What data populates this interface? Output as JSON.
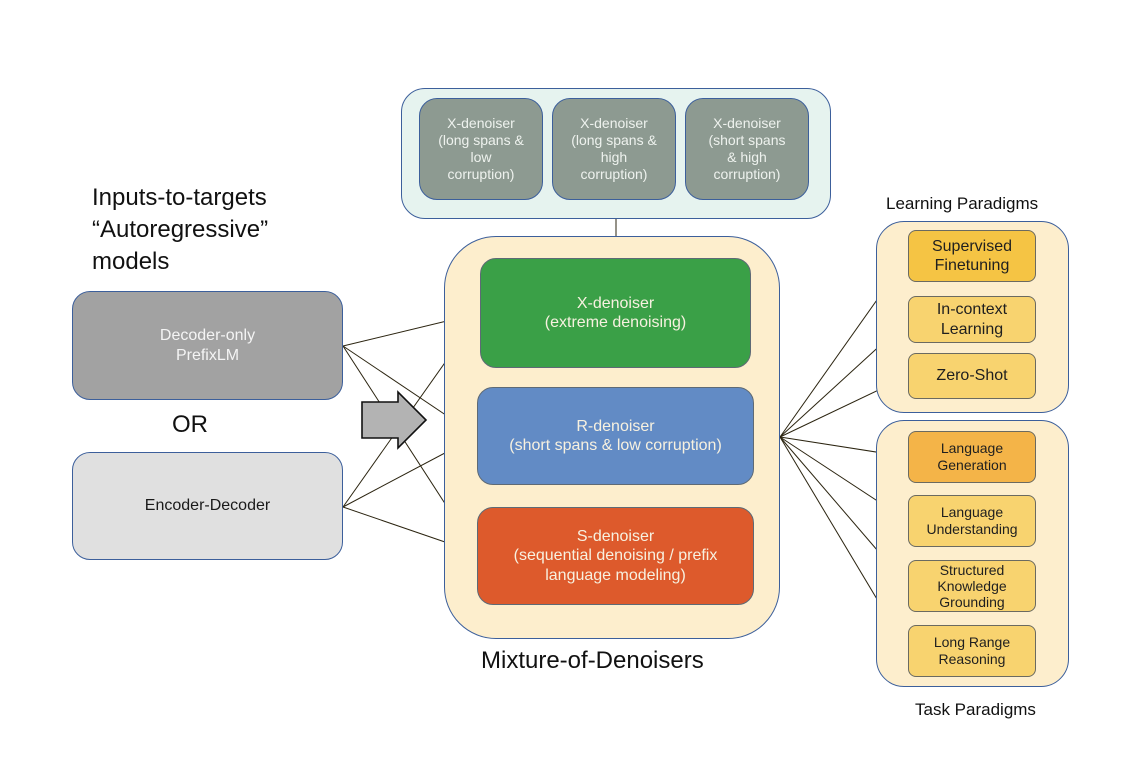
{
  "left": {
    "heading": "Inputs-to-targets\n“Autoregressive”\nmodels",
    "models": [
      {
        "label": "Decoder-only\nPrefixLM",
        "color": "#a2a2a2",
        "text_color": "#f4f4f4"
      },
      {
        "label": "Encoder-Decoder",
        "color": "#e0e0e0",
        "text_color": "#1a1a1a"
      }
    ],
    "or_label": "OR"
  },
  "top_group": {
    "items": [
      {
        "label": "X-denoiser\n(long spans &\nlow\ncorruption)"
      },
      {
        "label": "X-denoiser\n(long spans &\nhigh\ncorruption)"
      },
      {
        "label": "X-denoiser\n(short spans\n& high\ncorruption)"
      }
    ]
  },
  "mixture": {
    "title": "Mixture-of-Denoisers",
    "denoisers": [
      {
        "label": "X-denoiser\n(extreme denoising)",
        "color": "#3aa047"
      },
      {
        "label": "R-denoiser\n(short spans & low corruption)",
        "color": "#628bc5"
      },
      {
        "label": "S-denoiser\n(sequential denoising / prefix\nlanguage modeling)",
        "color": "#dd5a2c"
      }
    ]
  },
  "learning_paradigms": {
    "title": "Learning Paradigms",
    "items": [
      {
        "label": "Supervised\nFinetuning",
        "color": "#f5c444"
      },
      {
        "label": "In-context\nLearning",
        "color": "#f8d36f"
      },
      {
        "label": "Zero-Shot",
        "color": "#f8d36f"
      }
    ]
  },
  "task_paradigms": {
    "title": "Task Paradigms",
    "items": [
      {
        "label": "Language\nGeneration",
        "color": "#f4b448"
      },
      {
        "label": "Language\nUnderstanding",
        "color": "#f8d36f"
      },
      {
        "label": "Structured\nKnowledge\nGrounding",
        "color": "#f8d36f"
      },
      {
        "label": "Long Range\nReasoning",
        "color": "#f8d36f"
      }
    ]
  },
  "colors": {
    "border": "#3c5f9b",
    "group_fill": "#fdeecd",
    "top_group_fill": "#e6f3ef",
    "arrow": "#2b2410"
  }
}
